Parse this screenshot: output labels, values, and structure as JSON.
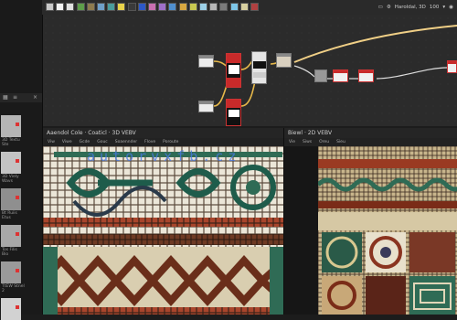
{
  "toolbar": {
    "status_text": "Haroldal, 3D",
    "zoom": "100",
    "button_colors": [
      "#c9c9c9",
      "#f2f2f2",
      "#e0e0e0",
      "#5e9e4a",
      "#8e7b4e",
      "#6fa0c9",
      "#4a9c9c",
      "#e8d24a",
      "#3a3a3a",
      "#2d58c8",
      "#c96fb0",
      "#9e6fc9",
      "#4f8fd0",
      "#d8a840",
      "#c8c850",
      "#9cd0e8",
      "#b8b8b8",
      "#7a7a7a",
      "#7ec6e8",
      "#d8d0a0",
      "#b04040"
    ]
  },
  "left_panel": {
    "materials": [
      {
        "label": "3D Textu\nSte",
        "color": "#b5b5b5"
      },
      {
        "label": "3D Viely\nWavs",
        "color": "#c3c3c3"
      },
      {
        "label": "Bt Ruiis\nEtus",
        "color": "#8f8f8f"
      },
      {
        "label": "Tos Filis\nBio",
        "color": "#a8a8a8"
      },
      {
        "label": "TtEW Stnel\n2",
        "color": "#9a9a9a"
      },
      {
        "label": "",
        "color": "#d2d2d2"
      }
    ]
  },
  "viewport_2d": {
    "title": "Aaendol Cole · Coaticl · 3D VEBV",
    "menu": [
      "Viw",
      "Viwe",
      "Gcde",
      "Gouc",
      "Soaennder",
      "Flove",
      "Poroute"
    ]
  },
  "viewport_3d": {
    "title": "Biewl · 2D VEBV",
    "menu": [
      "Vie",
      "Siws",
      "Oreu",
      "Sieu"
    ]
  },
  "watermark": "autorvxfb.cz"
}
